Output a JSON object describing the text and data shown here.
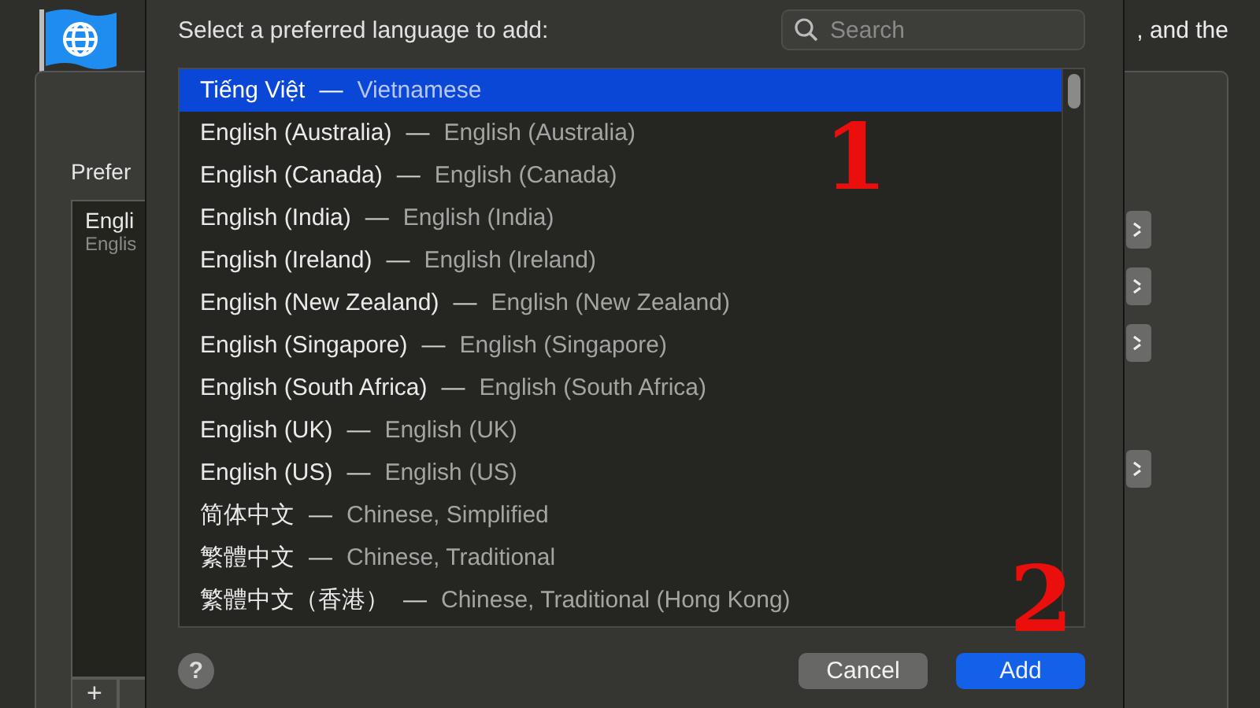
{
  "background_window": {
    "trailing_text": ", and the",
    "section_label": "Prefer",
    "preferred_languages": [
      {
        "name": "Engli",
        "detail": "Englis"
      }
    ],
    "add_button": "+"
  },
  "dialog": {
    "title": "Select a preferred language to add:",
    "search": {
      "placeholder": "Search"
    },
    "languages": [
      {
        "native": "Tiếng Việt",
        "separator": "—",
        "english": "Vietnamese",
        "selected": true
      },
      {
        "native": "English (Australia)",
        "separator": "—",
        "english": "English (Australia)",
        "selected": false
      },
      {
        "native": "English (Canada)",
        "separator": "—",
        "english": "English (Canada)",
        "selected": false
      },
      {
        "native": "English (India)",
        "separator": "—",
        "english": "English (India)",
        "selected": false
      },
      {
        "native": "English (Ireland)",
        "separator": "—",
        "english": "English (Ireland)",
        "selected": false
      },
      {
        "native": "English (New Zealand)",
        "separator": "—",
        "english": "English (New Zealand)",
        "selected": false
      },
      {
        "native": "English (Singapore)",
        "separator": "—",
        "english": "English (Singapore)",
        "selected": false
      },
      {
        "native": "English (South Africa)",
        "separator": "—",
        "english": "English (South Africa)",
        "selected": false
      },
      {
        "native": "English (UK)",
        "separator": "—",
        "english": "English (UK)",
        "selected": false
      },
      {
        "native": "English (US)",
        "separator": "—",
        "english": "English (US)",
        "selected": false
      },
      {
        "native": "简体中文",
        "separator": "—",
        "english": "Chinese, Simplified",
        "selected": false
      },
      {
        "native": "繁體中文",
        "separator": "—",
        "english": "Chinese, Traditional",
        "selected": false
      },
      {
        "native": "繁體中文（香港）",
        "separator": "—",
        "english": "Chinese, Traditional (Hong Kong)",
        "selected": false
      }
    ],
    "help_button": "?",
    "buttons": [
      {
        "label": "Cancel",
        "kind": "secondary"
      },
      {
        "label": "Add",
        "kind": "primary"
      }
    ]
  },
  "annotations": [
    {
      "text": "1"
    },
    {
      "text": "2"
    }
  ]
}
